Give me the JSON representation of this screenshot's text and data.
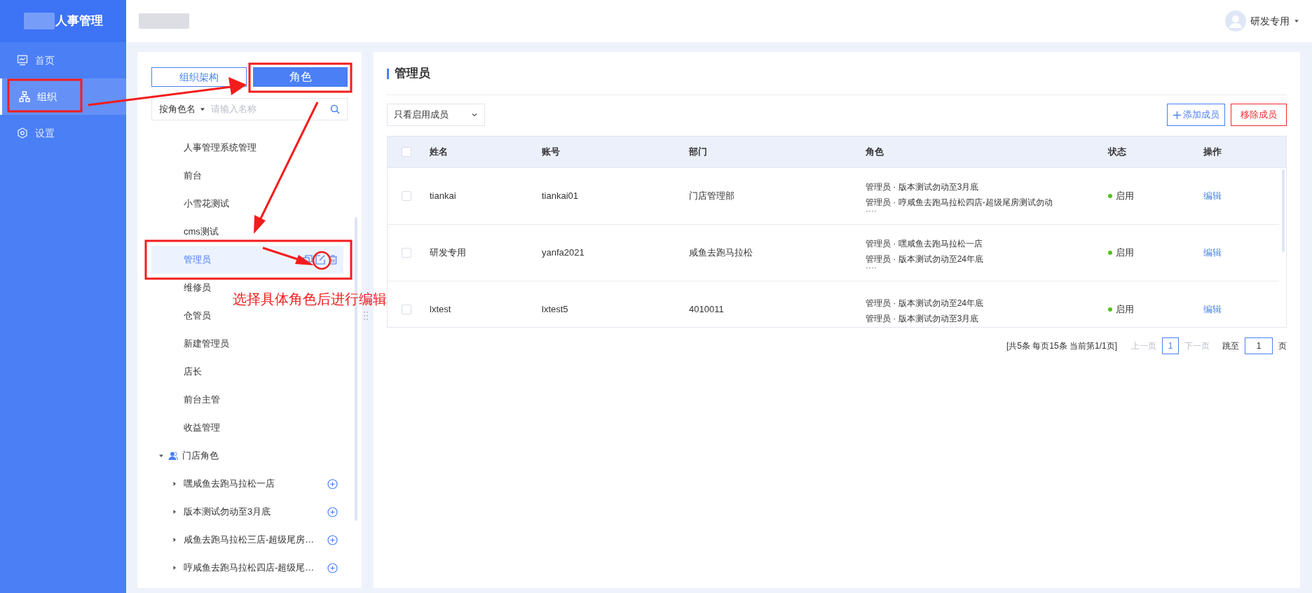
{
  "app": {
    "title": "人事管理"
  },
  "nav": [
    {
      "label": "首页",
      "selected": false
    },
    {
      "label": "组织",
      "selected": true
    },
    {
      "label": "设置",
      "selected": false
    }
  ],
  "user": {
    "name": "研发专用"
  },
  "left_panel": {
    "tabs": [
      {
        "label": "组织架构",
        "selected": false
      },
      {
        "label": "角色",
        "selected": true
      }
    ],
    "search": {
      "mode": "按角色名",
      "placeholder": "请输入名称"
    },
    "roles": [
      {
        "label": "人事管理系统管理",
        "selected": false
      },
      {
        "label": "前台",
        "selected": false
      },
      {
        "label": "小雪花测试",
        "selected": false
      },
      {
        "label": "cms测试",
        "selected": false
      },
      {
        "label": "管理员",
        "selected": true
      },
      {
        "label": "维修员",
        "selected": false
      },
      {
        "label": "仓管员",
        "selected": false
      },
      {
        "label": "新建管理员",
        "selected": false
      },
      {
        "label": "店长",
        "selected": false
      },
      {
        "label": "前台主管",
        "selected": false
      },
      {
        "label": "收益管理",
        "selected": false
      }
    ],
    "group": {
      "label": "门店角色",
      "expanded": true,
      "children": [
        {
          "label": "嘿咸鱼去跑马拉松一店",
          "expanded": false
        },
        {
          "label": "版本测试勿动至3月底",
          "expanded": false
        },
        {
          "label": "咸鱼去跑马拉松三店-超级尾房…",
          "expanded": false
        },
        {
          "label": "哼咸鱼去跑马拉松四店-超级尾…",
          "expanded": false
        }
      ]
    }
  },
  "main": {
    "title": "管理员",
    "filter": "只看启用成员",
    "buttons": [
      {
        "label": "添加成员",
        "kind": "add"
      },
      {
        "label": "移除成员",
        "kind": "remove"
      }
    ],
    "table": {
      "header_checked": false,
      "columns": [
        "姓名",
        "账号",
        "部门",
        "角色",
        "状态",
        "操作"
      ],
      "rows": [
        {
          "checked": false,
          "name": "tiankai",
          "account": "tiankai01",
          "department": "门店管理部",
          "roles": [
            "管理员 · 版本测试勿动至3月底",
            "管理员 · 哼咸鱼去跑马拉松四店-超级尾房测试勿动"
          ],
          "more": "····",
          "enabled": true,
          "status": "启用",
          "action": "编辑"
        },
        {
          "checked": false,
          "name": "研发专用",
          "account": "yanfa2021",
          "department": "咸鱼去跑马拉松",
          "roles": [
            "管理员 · 嘿咸鱼去跑马拉松一店",
            "管理员 · 版本测试勿动至24年底"
          ],
          "more": "····",
          "enabled": true,
          "status": "启用",
          "action": "编辑"
        },
        {
          "checked": false,
          "name": "lxtest",
          "account": "lxtest5",
          "department": "4010011",
          "roles": [
            "管理员 · 版本测试勿动至24年底",
            "管理员 · 版本测试勿动至3月底"
          ],
          "enabled": true,
          "status": "启用",
          "action": "编辑"
        }
      ]
    },
    "pagination": {
      "summary": "[共5条 每页15条 当前第1/1页]",
      "prev": {
        "label": "上一页",
        "disabled": true
      },
      "pages": [
        {
          "label": "1",
          "selected": true
        }
      ],
      "next": {
        "label": "下一页",
        "disabled": true
      },
      "jump_label": "跳至",
      "jump_value": "1",
      "page_unit": "页"
    }
  },
  "annotation": {
    "note": "选择具体角色后进行编辑"
  }
}
